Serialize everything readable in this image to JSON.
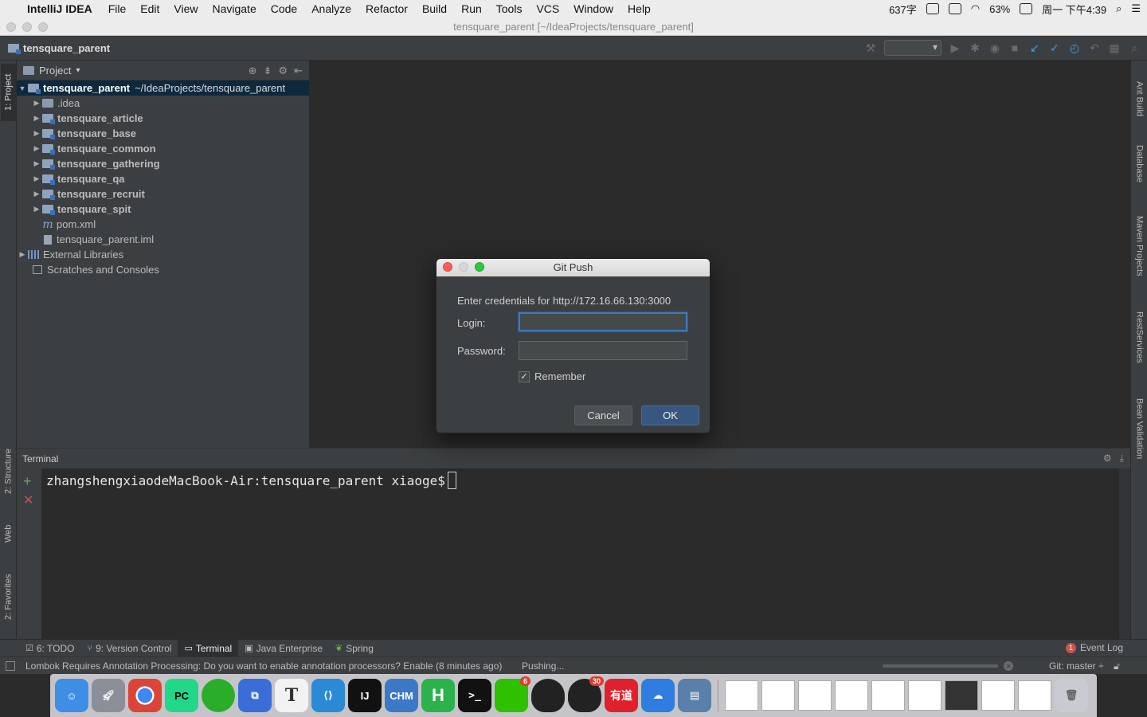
{
  "menubar": {
    "app_name": "IntelliJ IDEA",
    "items": [
      "File",
      "Edit",
      "View",
      "Navigate",
      "Code",
      "Analyze",
      "Refactor",
      "Build",
      "Run",
      "Tools",
      "VCS",
      "Window",
      "Help"
    ],
    "tray": {
      "word_count": "637字",
      "battery": "63%",
      "clock": "周一 下午4:39"
    }
  },
  "window": {
    "title": "tensquare_parent [~/IdeaProjects/tensquare_parent]"
  },
  "navbar": {
    "breadcrumb": "tensquare_parent"
  },
  "left_strip": {
    "project_tab": "1: Project",
    "structure_tab": "2: Structure",
    "web_tab": "Web",
    "favorites_tab": "2: Favorites"
  },
  "right_strip": {
    "ant": "Ant Build",
    "database": "Database",
    "maven": "Maven Projects",
    "rest": "RestServices",
    "bean": "Bean Validation"
  },
  "project": {
    "header": "Project",
    "root": {
      "name": "tensquare_parent",
      "path": "~/IdeaProjects/tensquare_parent"
    },
    "items": [
      {
        "label": ".idea"
      },
      {
        "label": "tensquare_article"
      },
      {
        "label": "tensquare_base"
      },
      {
        "label": "tensquare_common"
      },
      {
        "label": "tensquare_gathering"
      },
      {
        "label": "tensquare_qa"
      },
      {
        "label": "tensquare_recruit"
      },
      {
        "label": "tensquare_spit"
      }
    ],
    "pom": "pom.xml",
    "iml": "tensquare_parent.iml",
    "external_libraries": "External Libraries",
    "scratches": "Scratches and Consoles"
  },
  "terminal": {
    "title": "Terminal",
    "prompt": "zhangshengxiaodeMacBook-Air:tensquare_parent xiaoge$"
  },
  "bottom_tabs": {
    "todo": "6: TODO",
    "vcs": "9: Version Control",
    "terminal": "Terminal",
    "java_ee": "Java Enterprise",
    "spring": "Spring",
    "event_log": "Event Log",
    "event_count": "1"
  },
  "statusbar": {
    "message": "Lombok Requires Annotation Processing: Do you want to enable annotation processors? Enable (8 minutes ago)",
    "pushing": "Pushing...",
    "git_branch": "Git: master ÷"
  },
  "dock": {
    "wechat_badge": "6",
    "qq_badge": "30",
    "chm_label": "CHM",
    "youdao_label": "有道"
  },
  "dialog": {
    "title": "Git Push",
    "prompt": "Enter credentials for http://172.16.66.130:3000",
    "login_label": "Login:",
    "login_value": "",
    "password_label": "Password:",
    "password_value": "",
    "remember_label": "Remember",
    "remember_checked": true,
    "cancel_label": "Cancel",
    "ok_label": "OK"
  },
  "colors": {
    "accent": "#365880",
    "selection": "#0d293e",
    "panel": "#3c3f41",
    "editor": "#2b2b2b"
  }
}
